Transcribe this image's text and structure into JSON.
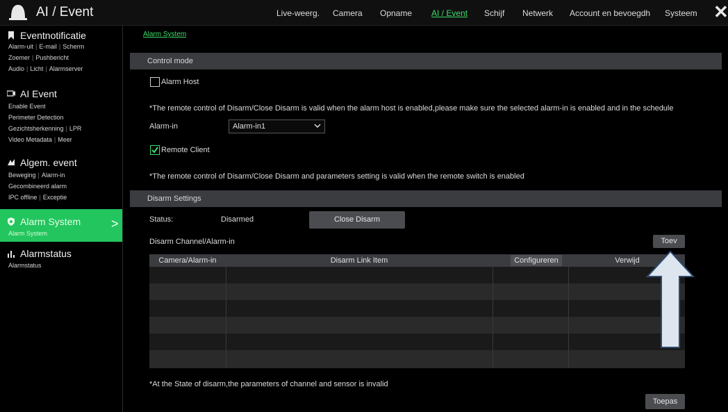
{
  "app": {
    "title": "AI / Event"
  },
  "topnav": [
    {
      "label": "Live-weerg.",
      "active": false
    },
    {
      "label": "Camera",
      "active": false
    },
    {
      "label": "Opname",
      "active": false
    },
    {
      "label": "AI / Event",
      "active": true
    },
    {
      "label": "Schijf",
      "active": false
    },
    {
      "label": "Netwerk",
      "active": false
    },
    {
      "label": "Account en bevoegdh",
      "active": false
    },
    {
      "label": "Systeem",
      "active": false
    }
  ],
  "sidebar": {
    "sections": [
      {
        "title": "Eventnotificatie",
        "icon": "bookmark-icon",
        "lines": [
          [
            "Alarm-uit",
            "E-mail",
            "Scherm"
          ],
          [
            "Zoemer",
            "Pushbericht"
          ],
          [
            "Audio",
            "Licht",
            "Alarmserver"
          ]
        ]
      },
      {
        "title": "AI Event",
        "icon": "ai-camera-icon",
        "lines": [
          [
            "Enable Event"
          ],
          [
            "Perimeter Detection"
          ],
          [
            "Gezichtsherkenning",
            "LPR"
          ],
          [
            "Video Metadata",
            "Meer"
          ]
        ]
      },
      {
        "title": "Algem. event",
        "icon": "general-event-icon",
        "lines": [
          [
            "Beweging",
            "Alarm-in"
          ],
          [
            "Gecombineerd alarm"
          ],
          [
            "IPC offline",
            "Exceptie"
          ]
        ]
      },
      {
        "title": "Alarm System",
        "icon": "shield-icon",
        "active": true,
        "lines": [
          [
            "Alarm System"
          ]
        ]
      },
      {
        "title": "Alarmstatus",
        "icon": "alarm-status-icon",
        "lines": [
          [
            "Alarmstatus"
          ]
        ]
      }
    ]
  },
  "main": {
    "breadcrumb": "Alarm System",
    "control_mode": {
      "header": "Control mode",
      "alarm_host": {
        "label": "Alarm Host",
        "checked": false
      },
      "note1": "*The remote control of Disarm/Close Disarm is valid when the alarm host is enabled,please make sure the selected alarm-in is enabled and in the schedule",
      "alarm_in_label": "Alarm-in",
      "alarm_in_value": "Alarm-in1",
      "remote_client": {
        "label": "Remote Client",
        "checked": true
      },
      "note2": "*The remote control of Disarm/Close Disarm and parameters setting is valid when the remote switch is enabled"
    },
    "disarm": {
      "header": "Disarm Settings",
      "status_label": "Status:",
      "status_value": "Disarmed",
      "close_disarm_button": "Close Disarm",
      "channel_label": "Disarm Channel/Alarm-in",
      "add_button": "Toev",
      "table": {
        "columns": [
          "Camera/Alarm-in",
          "Disarm Link Item",
          "Configureren",
          "Verwijd"
        ],
        "rows": []
      },
      "note": "*At the State of disarm,the parameters of channel and sensor is invalid",
      "apply_button": "Toepas"
    }
  },
  "colors": {
    "accent": "#22c55e",
    "link": "#3ddc6a",
    "band": "#3a3c40",
    "arrow_fill": "#dde6ef",
    "arrow_stroke": "#2f4a6e"
  }
}
